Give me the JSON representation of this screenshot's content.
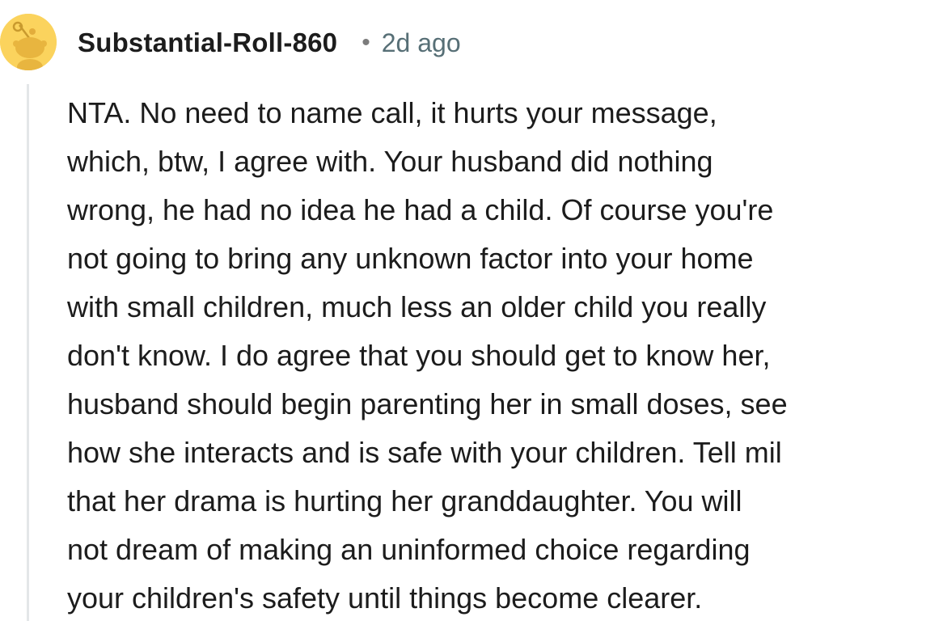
{
  "comment": {
    "username": "Substantial-Roll-860",
    "separator": "•",
    "timestamp": "2d ago",
    "avatar_icon": "snoo-avatar-icon",
    "body_lines": [
      "NTA. No need to name call, it hurts your message,",
      "which, btw, I agree with. Your husband did nothing",
      "wrong, he had no idea he had a child. Of course you're",
      "not going to bring any unknown factor into your home",
      "with small children, much less an older child you really",
      "don't know. I do agree that you should get to know her,",
      "husband should begin parenting her in small doses, see",
      "how she interacts and is safe with your children. Tell mil",
      "that her drama is hurting her granddaughter. You will",
      "not dream of making an uninformed choice regarding",
      "your children's safety until things become clearer."
    ]
  },
  "colors": {
    "avatar_bg": "#fbd35d",
    "text": "#1c1c1c",
    "timestamp": "#576f76",
    "thread_line": "#e3e6e8"
  }
}
